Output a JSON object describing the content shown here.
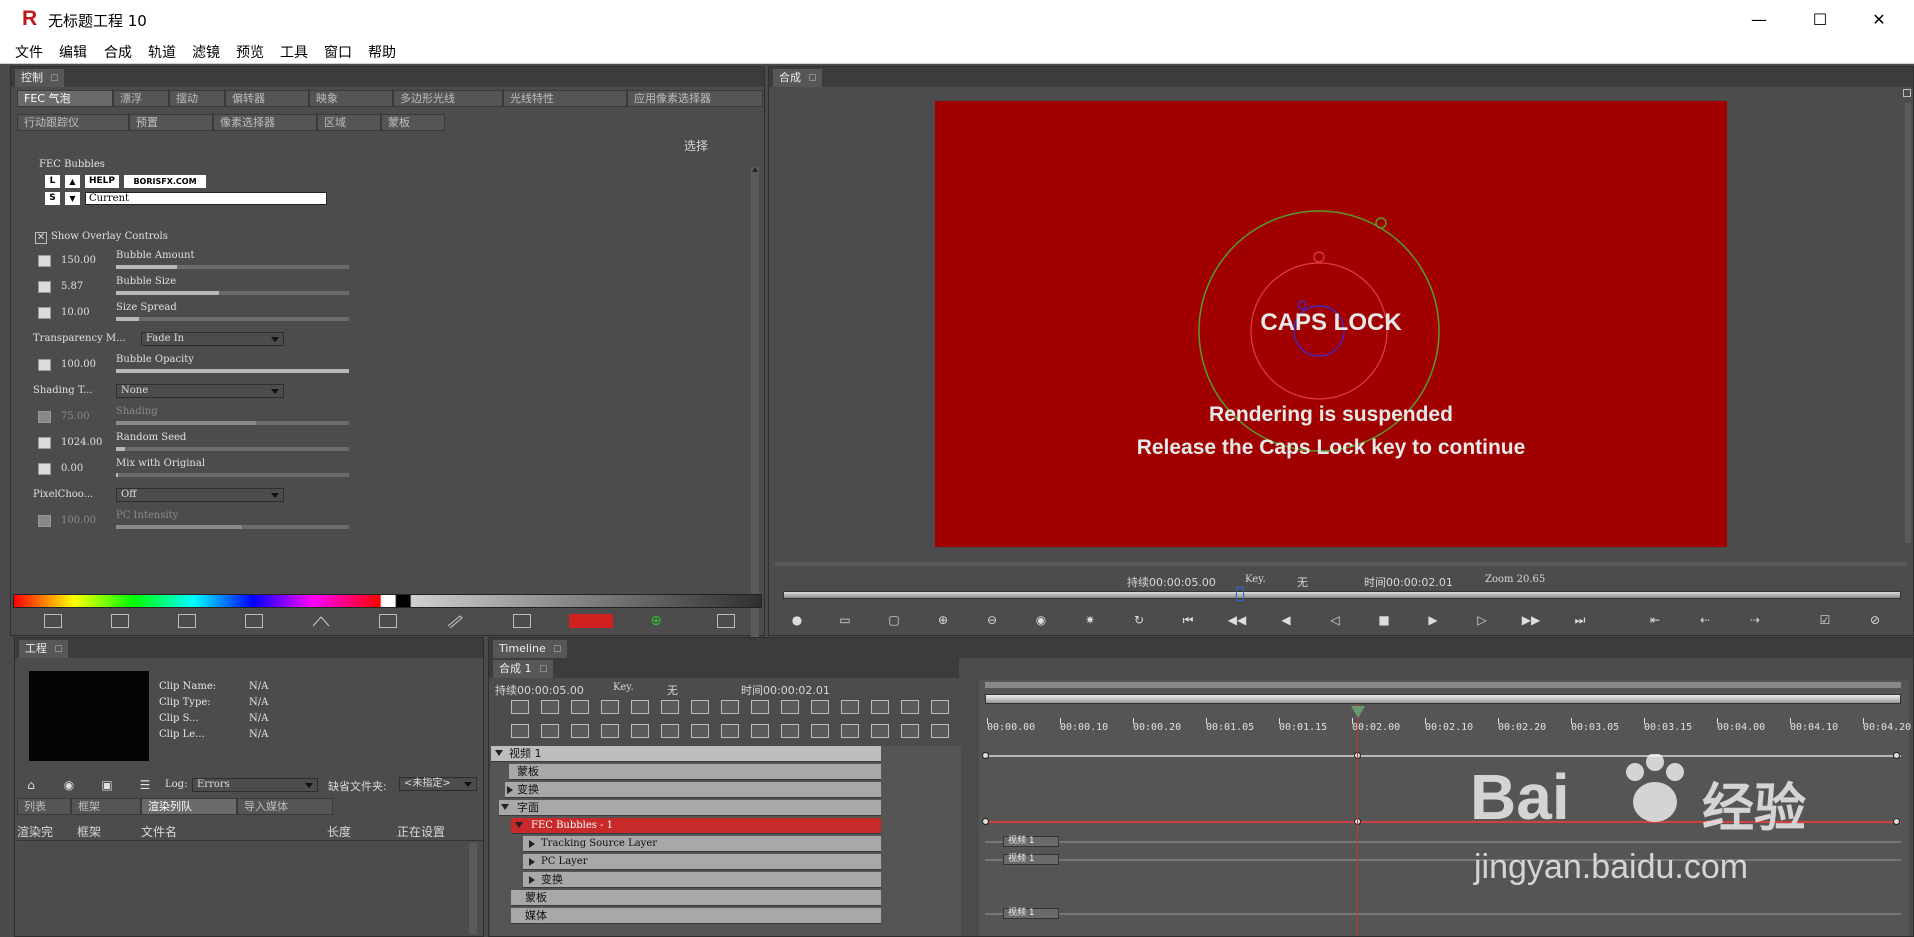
{
  "window": {
    "logo": "R",
    "title": "无标题工程 10",
    "min": "—",
    "max": "☐",
    "close": "✕"
  },
  "menu": [
    "文件",
    "编辑",
    "合成",
    "轨道",
    "滤镜",
    "预览",
    "工具",
    "窗口",
    "帮助"
  ],
  "control": {
    "tab": "控制",
    "filter_tabs_row1": [
      "FEC 气泡",
      "漂浮",
      "摆动",
      "偏转器",
      "映象",
      "多边形光线",
      "光线特性",
      "应用像素选择器"
    ],
    "filter_tabs_row2": [
      "行动跟踪仪",
      "预置",
      "像素选择器",
      "区域",
      "蒙板"
    ],
    "select_label": "选择",
    "plugin_title": "FEC Bubbles",
    "btn_l": "L",
    "btn_up": "▲",
    "btn_help": "HELP",
    "btn_boris": "BORISFX.COM",
    "btn_s": "S",
    "btn_down": "▼",
    "preset_value": "Current",
    "show_overlay": "Show Overlay Controls",
    "params": [
      {
        "value": "150.00",
        "label": "Bubble Amount",
        "fill": 0.26
      },
      {
        "value": "5.87",
        "label": "Bubble Size",
        "fill": 0.44
      },
      {
        "value": "10.00",
        "label": "Size Spread",
        "fill": 0.1
      },
      {
        "value": "100.00",
        "label": "Bubble Opacity",
        "fill": 1.0
      },
      {
        "value": "75.00",
        "label": "Shading",
        "fill": 0.6
      },
      {
        "value": "1024.00",
        "label": "Random Seed",
        "fill": 0.04
      },
      {
        "value": "0.00",
        "label": "Mix with Original",
        "fill": 0.01
      },
      {
        "value": "100.00",
        "label": "PC Intensity",
        "fill": 0.54
      }
    ],
    "transparency_label": "Transparency M...",
    "transparency_value": "Fade In",
    "shading_label": "Shading T...",
    "shading_value": "None",
    "pixelchoo_label": "PixelChoo...",
    "pixelchoo_value": "Off"
  },
  "composite": {
    "tab": "合成",
    "caps_lock": "CAPS LOCK",
    "msg1": "Rendering is suspended",
    "msg2": "Release the Caps Lock key to continue",
    "duration": "持续00:00:05.00",
    "key_label": "Key.",
    "key_value": "无",
    "time": "时间00:00:02.01",
    "zoom": "Zoom  20.65",
    "canvas_color": "#a00000"
  },
  "project": {
    "tab": "工程",
    "clip_name_label": "Clip Name:",
    "clip_name": "N/A",
    "clip_type_label": "Clip Type:",
    "clip_type": "N/A",
    "clip_s_label": "Clip S...",
    "clip_s": "N/A",
    "clip_le_label": "Clip Le...",
    "clip_le": "N/A",
    "log_label": "Log:",
    "log_value": "Errors",
    "missing_label": "缺省文件夹:",
    "missing_value": "<未指定>",
    "tabs": [
      "列表",
      "框架",
      "渲染列队",
      "导入媒体"
    ],
    "columns": [
      "渲染完",
      "框架",
      "文件名",
      "长度",
      "正在设置"
    ]
  },
  "timeline": {
    "tab": "Timeline",
    "subtab": "合成 1",
    "duration": "持续00:00:05.00",
    "key_label": "Key.",
    "key_value": "无",
    "time": "时间00:00:02.01",
    "ticks": [
      "00:00.00",
      "00:00.10",
      "00:00.20",
      "00:01.05",
      "00:01.15",
      "00:02.00",
      "00:02.10",
      "00:02.20",
      "00:03.05",
      "00:03.15",
      "00:04.00",
      "00:04.10",
      "00:04.20"
    ],
    "tracks": [
      {
        "name": "视频 1"
      },
      {
        "name": "蒙板"
      },
      {
        "name": "变换"
      },
      {
        "name": "字面"
      },
      {
        "name": "FEC Bubbles - 1"
      },
      {
        "name": "Tracking Source Layer"
      },
      {
        "name": "PC Layer"
      },
      {
        "name": "变换"
      },
      {
        "name": "蒙板"
      },
      {
        "name": "媒体"
      }
    ],
    "chips": [
      "视频 1",
      "视频 1",
      "视频 1"
    ],
    "playhead_color": "#d03030"
  },
  "watermark": {
    "line1": "Bai",
    "line1b": "经验",
    "line2": "jingyan.baidu.com"
  }
}
